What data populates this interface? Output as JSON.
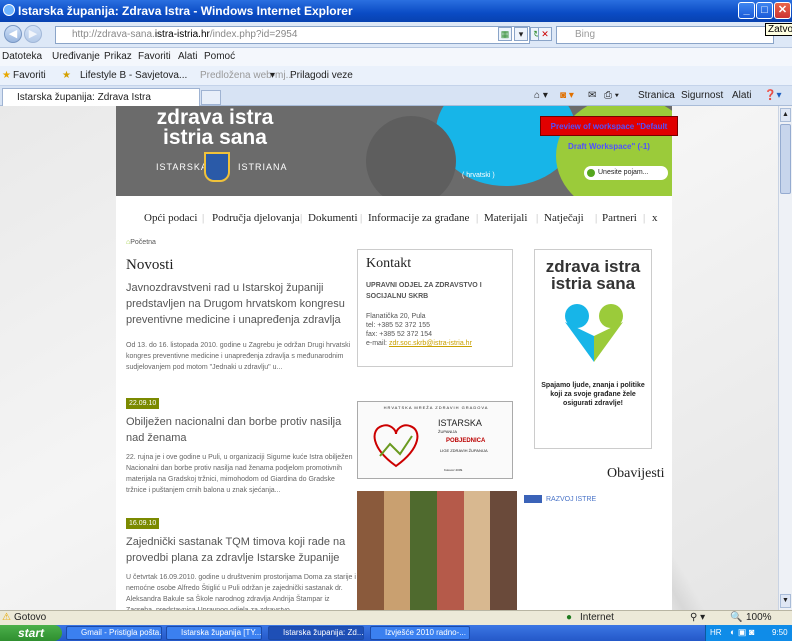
{
  "window": {
    "title": "Istarska županija: Zdrava Istra - Windows Internet Explorer",
    "close_tooltip": "Zatvo"
  },
  "address": {
    "url_prefix": "http://zdrava-sana.",
    "url_domain": "istra-istria.hr",
    "url_suffix": "/index.php?id=2954",
    "search_placeholder": "Bing"
  },
  "menu": [
    "Datoteka",
    "Uređivanje",
    "Prikaz",
    "Favoriti",
    "Alati",
    "Pomoć"
  ],
  "favorites": {
    "label": "Favoriti",
    "items": [
      "Lifestyle B - Savjetova...",
      "Predložena web-mj...",
      "Prilagodi veze"
    ]
  },
  "tab": {
    "title": "Istarska županija: Zdrava Istra"
  },
  "commands": [
    "Stranica",
    "Sigurnost",
    "Alati"
  ],
  "site": {
    "logo_line1": "zdrava istra",
    "logo_line2": "istria sana",
    "istarska": "ISTARSKA",
    "istarska_small": "ŽUPANIJA",
    "istriana": "ISTRIANA",
    "istriana_small": "REGIONE",
    "lang": "( hrvatski )",
    "search_placeholder": "Unesite pojam...",
    "preview": "Preview of workspace \"Default Draft Workspace\" (-1)",
    "nav": [
      "Opći podaci",
      "Područja djelovanja",
      "Dokumenti",
      "Informacije za građane",
      "Materijali",
      "Natječaji",
      "Partneri",
      "x"
    ],
    "breadcrumb": "Početna",
    "news_heading": "Novosti",
    "articles": [
      {
        "date": "",
        "title": "Javnozdravstveni rad u Istarskoj županiji predstavljen na Drugom hrvatskom kongresu preventivne medicine i unapređenja zdravlja",
        "text": "Od 13. do 16. listopada 2010. godine u Zagrebu je održan Drugi hrvatski kongres preventivne medicine i unapređenja zdravlja s međunarodnim sudjelovanjem pod motom \"Jednaki u zdravlju\" u..."
      },
      {
        "date": "22.09.10",
        "title": "Obilježen nacionalni dan borbe protiv nasilja nad ženama",
        "text": "22. rujna je i ove godine u Puli, u organizaciji Sigurne kuće Istra obilježen Nacionalni dan borbe protiv nasilja nad ženama podjelom promotivnih materijala na Gradskoj tržnici, mimohodom od Giardina do Gradske tržnice i puštanjem crnih balona u znak sjećanja..."
      },
      {
        "date": "16.09.10",
        "title": "Zajednički sastanak TQM timova koji rade na provedbi plana za zdravlje Istarske županije",
        "text": "U četvrtak 16.09.2010. godine u društvenim prostorijama Doma za starije i nemoćne osobe Alfredo Štiglić u Puli održan je zajednički sastanak dr. Aleksandra Bakule sa Škole narodnog zdravlja Andrija Štampar iz Zagreba, predstavnica Upravnog odjela za zdravstvo..."
      }
    ],
    "kontakt": {
      "heading": "Kontakt",
      "org": "UPRAVNI ODJEL ZA ZDRAVSTVO I SOCIJALNU SKRB",
      "address": "Flanatička 20, Pula",
      "tel": "tel: +385 52 372 155",
      "fax": "fax: +385 52 372 154",
      "email_label": "e-mail: ",
      "email": "zdr.soc.skrb@istra-istria.hr"
    },
    "promo": {
      "line1": "zdrava istra",
      "line2": "istria sana",
      "slogan": "Spajamo ljude, znanja i politike koji za svoje građane žele osigurati zdravlje!"
    },
    "booklet": {
      "top": "HRVATSKA MREŽA ZDRAVIH GRADOVA",
      "title": "ISTARSKA",
      "sub": "ŽUPANIJA",
      "name": "POBJEDNICA",
      "small": "LIGE ZDRAVIH ŽUPANIJA",
      "year": "Kolovoz 2009."
    },
    "obavijesti": "Obavijesti",
    "razvoj": "RAZVOJ ISTRE"
  },
  "status": {
    "left": "Gotovo",
    "zone": "Internet",
    "zoom": "100%"
  },
  "taskbar": {
    "start": "start",
    "tasks": [
      "Gmail - Pristigla pošta...",
      "Istarska županija [TY...",
      "Istarska županija: Zd...",
      "Izvješće 2010 radno-..."
    ],
    "lang": "HR",
    "time": "9:50"
  },
  "colors": {
    "green": "#9bcb3a",
    "cyan": "#17b5e8",
    "olive": "#7b8a00",
    "preview_bg": "#e00000"
  }
}
